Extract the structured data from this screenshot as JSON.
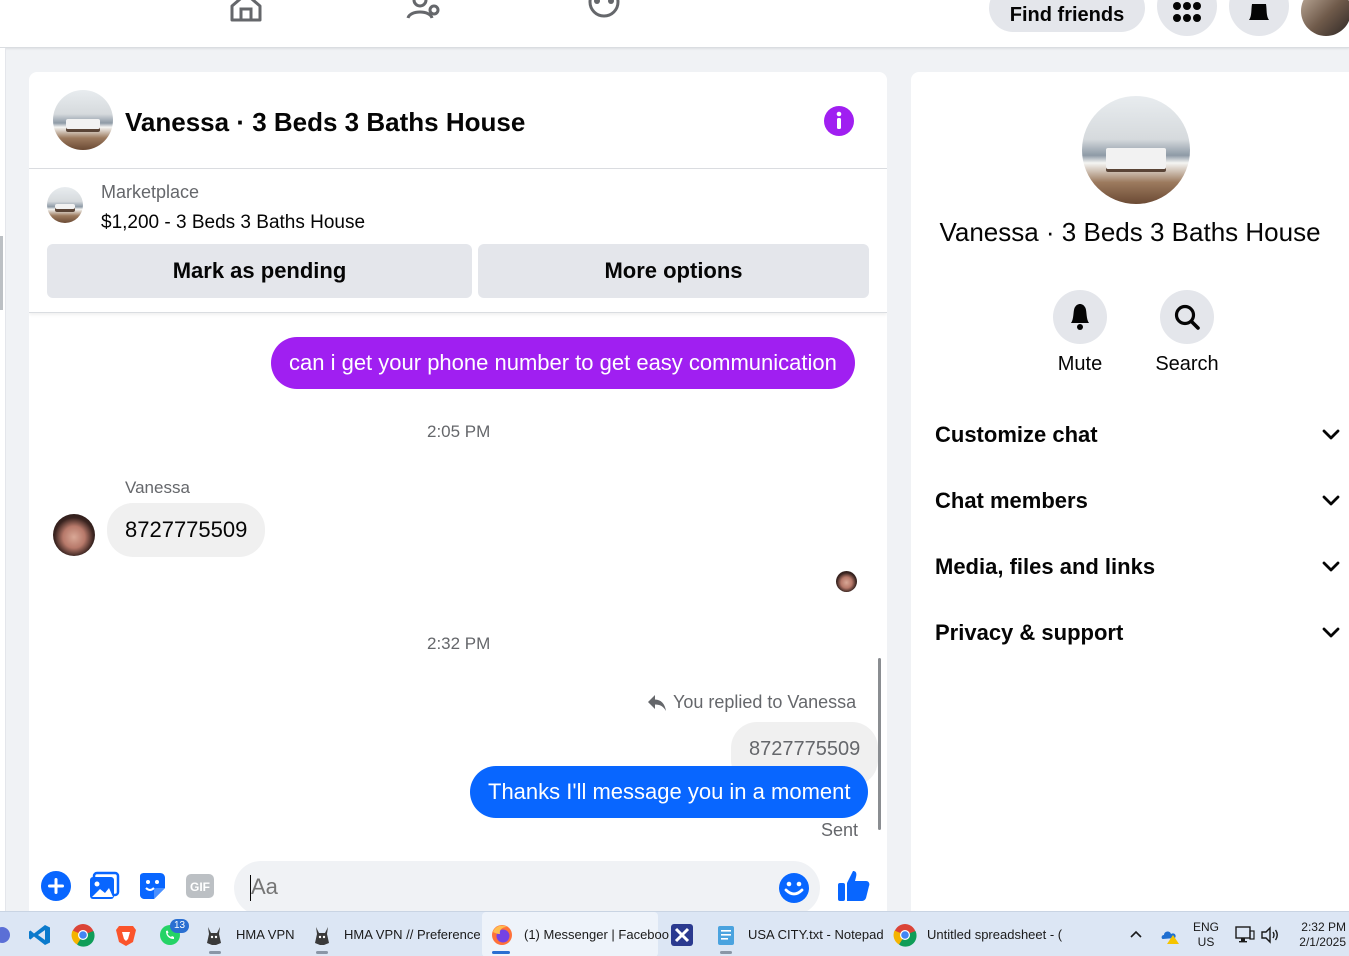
{
  "topbar": {
    "find_friends_label": "Find friends"
  },
  "chat": {
    "title": "Vanessa · 3 Beds 3 Baths House",
    "marketplace": {
      "label": "Marketplace",
      "listing": "$1,200 - 3 Beds 3 Baths House"
    },
    "buttons": {
      "mark_pending": "Mark as pending",
      "more_options": "More options"
    },
    "messages": {
      "outgoing_1": "can i get your phone number to get easy communication",
      "time_1": "2:05 PM",
      "sender_name": "Vanessa",
      "incoming_1": "8727775509",
      "time_2": "2:32 PM",
      "replied_label": "You replied to Vanessa",
      "quoted": "8727775509",
      "outgoing_2": "Thanks I'll message you in a moment",
      "status": "Sent"
    },
    "composer": {
      "placeholder": "Aa"
    },
    "colors": {
      "accent_purple": "#a01ff1",
      "accent_blue": "#0866ff"
    }
  },
  "info_panel": {
    "title": "Vanessa · 3 Beds 3 Baths House",
    "actions": {
      "mute": "Mute",
      "search": "Search"
    },
    "sections": [
      {
        "label": "Customize chat"
      },
      {
        "label": "Chat members"
      },
      {
        "label": "Media, files and links"
      },
      {
        "label": "Privacy & support"
      }
    ]
  },
  "taskbar": {
    "items": [
      {
        "label": "HMA VPN"
      },
      {
        "label": "HMA VPN // Preference"
      },
      {
        "label": "(1) Messenger | Faceboo"
      },
      {
        "label": "USA CITY.txt - Notepad"
      },
      {
        "label": "Untitled spreadsheet - ("
      }
    ],
    "whatsapp_badge": "13",
    "language": "ENG",
    "region": "US",
    "time": "2:32 PM",
    "date": "2/1/2025"
  }
}
